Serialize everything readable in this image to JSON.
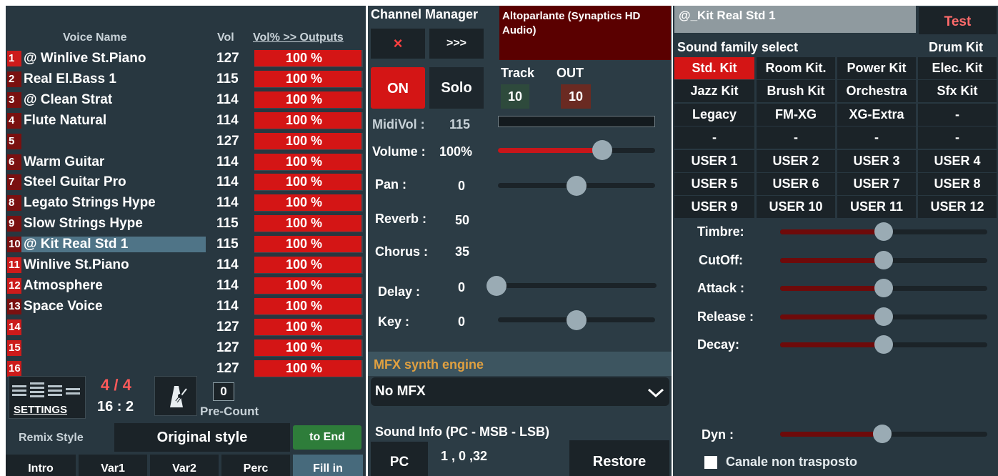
{
  "voices": {
    "header_name": "Voice Name",
    "header_vol": "Vol",
    "header_out": "Vol% >> Outputs",
    "rows": [
      {
        "num": "1",
        "name": "@  Winlive St.Piano",
        "vol": "127",
        "pct": "100 %"
      },
      {
        "num": "2",
        "name": "Real El.Bass 1",
        "vol": "115",
        "pct": "100 %"
      },
      {
        "num": "3",
        "name": "@  Clean Strat",
        "vol": "114",
        "pct": "100 %"
      },
      {
        "num": "4",
        "name": "Flute Natural",
        "vol": "114",
        "pct": "100 %"
      },
      {
        "num": "5",
        "name": "",
        "vol": "127",
        "pct": "100 %"
      },
      {
        "num": "6",
        "name": "Warm Guitar",
        "vol": "114",
        "pct": "100 %"
      },
      {
        "num": "7",
        "name": "Steel Guitar Pro",
        "vol": "114",
        "pct": "100 %"
      },
      {
        "num": "8",
        "name": "Legato Strings Hype",
        "vol": "114",
        "pct": "100 %"
      },
      {
        "num": "9",
        "name": "Slow Strings Hype",
        "vol": "115",
        "pct": "100 %"
      },
      {
        "num": "10",
        "name": "@  Kit Real Std 1",
        "vol": "115",
        "pct": "100 %"
      },
      {
        "num": "11",
        "name": "Winlive St.Piano",
        "vol": "114",
        "pct": "100 %"
      },
      {
        "num": "12",
        "name": "Atmosphere",
        "vol": "114",
        "pct": "100 %"
      },
      {
        "num": "13",
        "name": "Space Voice",
        "vol": "114",
        "pct": "100 %"
      },
      {
        "num": "14",
        "name": "",
        "vol": "127",
        "pct": "100 %"
      },
      {
        "num": "15",
        "name": "",
        "vol": "127",
        "pct": "100 %"
      },
      {
        "num": "16",
        "name": "",
        "vol": "127",
        "pct": "100 %"
      }
    ],
    "selected_index": 9,
    "highlighted": [
      1,
      11,
      12,
      14,
      15,
      16
    ]
  },
  "transport": {
    "settings_label": "SETTINGS",
    "time_sig": "4 / 4",
    "position": "16 : 2",
    "precount_value": "0",
    "precount_label": "Pre-Count"
  },
  "remix": {
    "label": "Remix Style",
    "style": "Original style",
    "to_end": "to End",
    "buttons": [
      "Intro",
      "Var1",
      "Var2",
      "Perc",
      "Fill in"
    ]
  },
  "channel": {
    "title": "Channel Manager",
    "output_device": "Altoparlante (Synaptics HD Audio)",
    "close_label": "×",
    "forward_label": ">>>",
    "on_label": "ON",
    "solo_label": "Solo",
    "track_label": "Track",
    "track_value": "10",
    "out_label": "OUT",
    "out_value": "10",
    "midivol_label": "MidiVol :",
    "midivol_value": "115",
    "volume_label": "Volume :",
    "volume_value": "100%",
    "volume_level": 0.67,
    "pan_label": "Pan :",
    "pan_value": "0",
    "pan_level": 0.5,
    "reverb_label": "Reverb :",
    "reverb_value": "50",
    "chorus_label": "Chorus :",
    "chorus_value": "35",
    "delay_label": "Delay :",
    "delay_value": "0",
    "delay_level": 0.0,
    "key_label": "Key :",
    "key_value": "0",
    "key_level": 0.5,
    "mfx_title": "MFX synth engine",
    "mfx_value": "No MFX",
    "sound_info_title": "Sound Info (PC - MSB - LSB)",
    "pc_label": "PC",
    "pc_values": "1 , 0 ,32",
    "restore_label": "Restore"
  },
  "kits": {
    "current_name": "@_Kit Real Std 1",
    "test_label": "Test",
    "family_label": "Sound family select",
    "drum_kit_label": "Drum Kit",
    "grid": [
      [
        "Std. Kit",
        "Room Kit.",
        "Power Kit",
        "Elec. Kit"
      ],
      [
        "Jazz Kit",
        "Brush Kit",
        "Orchestra",
        "Sfx Kit"
      ],
      [
        "Legacy",
        "FM-XG",
        "XG-Extra",
        "-"
      ],
      [
        "-",
        "-",
        "-",
        "-"
      ],
      [
        "USER 1",
        "USER 2",
        "USER 3",
        "USER 4"
      ],
      [
        "USER 5",
        "USER 6",
        "USER 7",
        "USER 8"
      ],
      [
        "USER 9",
        "USER 10",
        "USER 11",
        "USER 12"
      ]
    ],
    "active": "Std. Kit",
    "params": [
      {
        "label": "Timbre:",
        "level": 0.5
      },
      {
        "label": "CutOff:",
        "level": 0.5
      },
      {
        "label": "Attack :",
        "level": 0.5
      },
      {
        "label": "Release :",
        "level": 0.5
      },
      {
        "label": "Decay:",
        "level": 0.5
      }
    ],
    "dyn_label": "Dyn :",
    "dyn_level": 0.5,
    "not_transposed_label": "Canale non trasposto"
  },
  "colors": {
    "panel_bg": "#283740",
    "button_bg": "#1b2328",
    "accent_red": "#d41515",
    "selection": "#4f7487",
    "mfx_header": "#e0a040",
    "to_end_green": "#2e7d3a"
  }
}
